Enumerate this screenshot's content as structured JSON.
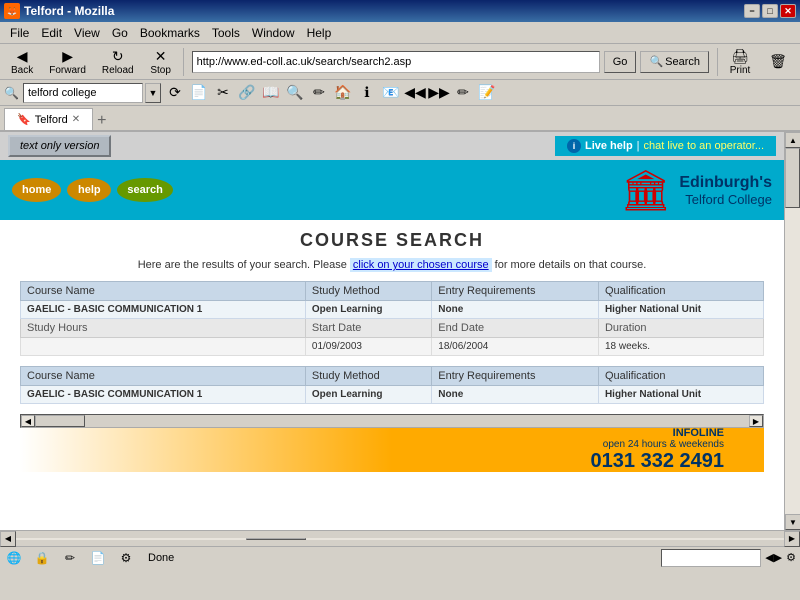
{
  "window": {
    "title": "Telford - Mozilla",
    "minimize": "−",
    "maximize": "□",
    "close": "✕"
  },
  "menubar": {
    "items": [
      "File",
      "Edit",
      "View",
      "Go",
      "Bookmarks",
      "Tools",
      "Window",
      "Help"
    ]
  },
  "toolbar": {
    "back_label": "Back",
    "forward_label": "Forward",
    "reload_label": "Reload",
    "stop_label": "Stop",
    "address": "http://www.ed-coll.ac.uk/search/search2.asp",
    "go_label": "Go",
    "search_label": "Search",
    "print_label": "Print"
  },
  "toolbar2": {
    "search_value": "telford college"
  },
  "tab": {
    "label": "Telford",
    "favicon": "🔖"
  },
  "site": {
    "text_only_label": "text only version",
    "live_help_label": "Live help",
    "chat_label": "chat live to an operator...",
    "nav_home": "home",
    "nav_help": "help",
    "nav_search": "search",
    "college_line1": "Edinburgh's",
    "college_line2": "Telford College",
    "page_title": "COURSE SEARCH",
    "result_desc_before": "Here are the results of your search. Please ",
    "result_link": "click on your chosen course",
    "result_desc_after": " for more details on that course."
  },
  "table1": {
    "headers": [
      "Course Name",
      "Study Method",
      "Entry Requirements",
      "Qualification"
    ],
    "row1": [
      "GAELIC - BASIC COMMUNICATION 1",
      "Open Learning",
      "None",
      "Higher National Unit"
    ],
    "sub_headers": [
      "Study Hours",
      "Start Date",
      "End Date",
      "Duration"
    ],
    "sub_row": [
      "",
      "01/09/2003",
      "18/06/2004",
      "18 weeks."
    ]
  },
  "table2": {
    "headers": [
      "Course Name",
      "Study Method",
      "Entry Requirements",
      "Qualification"
    ],
    "row1": [
      "GAELIC - BASIC COMMUNICATION 1",
      "Open Learning",
      "None",
      "Higher National Unit"
    ]
  },
  "infoline": {
    "label": "INFOLINE",
    "sublabel": "open 24 hours & weekends",
    "number": "0131 332 2491"
  },
  "status": {
    "text": "Done"
  }
}
